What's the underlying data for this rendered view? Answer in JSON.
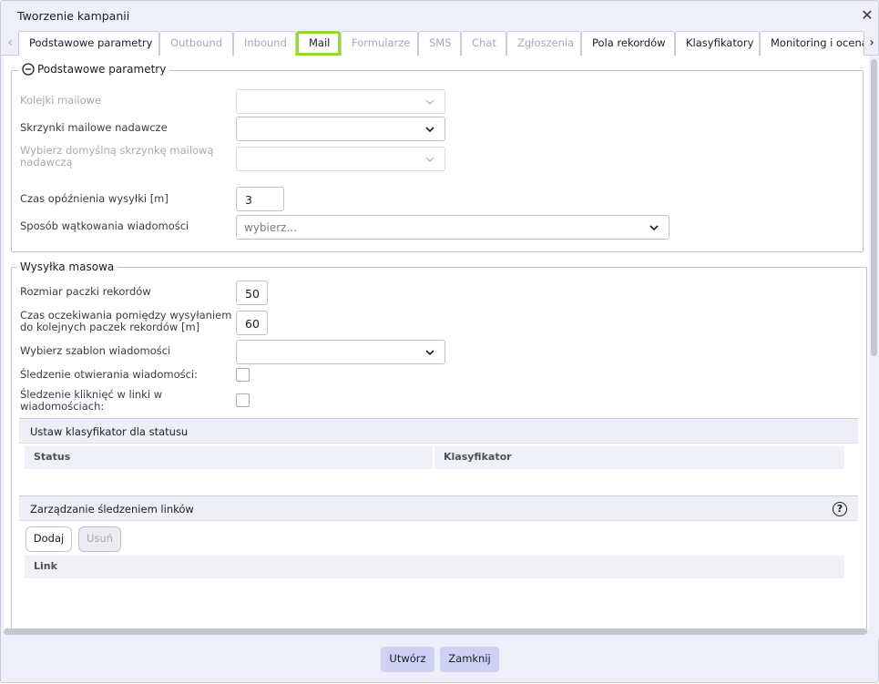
{
  "window": {
    "title": "Tworzenie kampanii"
  },
  "tabs": [
    {
      "label": "Podstawowe parametry",
      "state": "normal"
    },
    {
      "label": "Outbound",
      "state": "disabled"
    },
    {
      "label": "Inbound",
      "state": "disabled"
    },
    {
      "label": "Mail",
      "state": "active"
    },
    {
      "label": "Formularze",
      "state": "disabled"
    },
    {
      "label": "SMS",
      "state": "disabled"
    },
    {
      "label": "Chat",
      "state": "disabled"
    },
    {
      "label": "Zgłoszenia",
      "state": "disabled"
    },
    {
      "label": "Pola rekordów",
      "state": "normal"
    },
    {
      "label": "Klasyfikatory",
      "state": "normal"
    },
    {
      "label": "Monitoring i ocena",
      "state": "normal"
    }
  ],
  "basic": {
    "legend": "Podstawowe parametry",
    "collapse_icon": "minus-circle-icon",
    "mail_queues_label": "Kolejki mailowe",
    "sender_mailboxes_label": "Skrzynki mailowe nadawcze",
    "default_mailbox_label_line1": "Wybierz domyślną skrzynkę mailową",
    "default_mailbox_label_line2": "nadawczą",
    "send_delay_label": "Czas opóźnienia wysyłki [m]",
    "send_delay_value": "3",
    "threading_label": "Sposób wątkowania wiadomości",
    "threading_placeholder": "wybierz..."
  },
  "mass": {
    "legend": "Wysyłka masowa",
    "batch_size_label": "Rozmiar paczki rekordów",
    "batch_size_value": "50",
    "wait_label_line1": "Czas oczekiwania pomiędzy wysyłaniem",
    "wait_label_line2": "do kolejnych paczek rekordów [m]",
    "wait_value": "60",
    "template_label": "Wybierz szablon wiadomości",
    "open_tracking_label": "Śledzenie otwierania wiadomości:",
    "open_tracking_checked": false,
    "click_tracking_label_line1": "Śledzenie kliknięć w linki w",
    "click_tracking_label_line2": "wiadomościach:",
    "click_tracking_checked": false
  },
  "status_classifier": {
    "title": "Ustaw klasyfikator dla statusu",
    "columns": [
      "Status",
      "Klasyfikator"
    ]
  },
  "link_tracking": {
    "title": "Zarządzanie śledzeniem linków",
    "help_icon": "question-circle-icon",
    "add_label": "Dodaj",
    "remove_label": "Usuń",
    "columns": [
      "Link"
    ]
  },
  "footer": {
    "create_label": "Utwórz",
    "close_label": "Zamknij"
  },
  "colors": {
    "accent_highlight": "#8fde2a",
    "primary_button": "#cfd1f4",
    "dialog_bg": "#eeeff8"
  }
}
